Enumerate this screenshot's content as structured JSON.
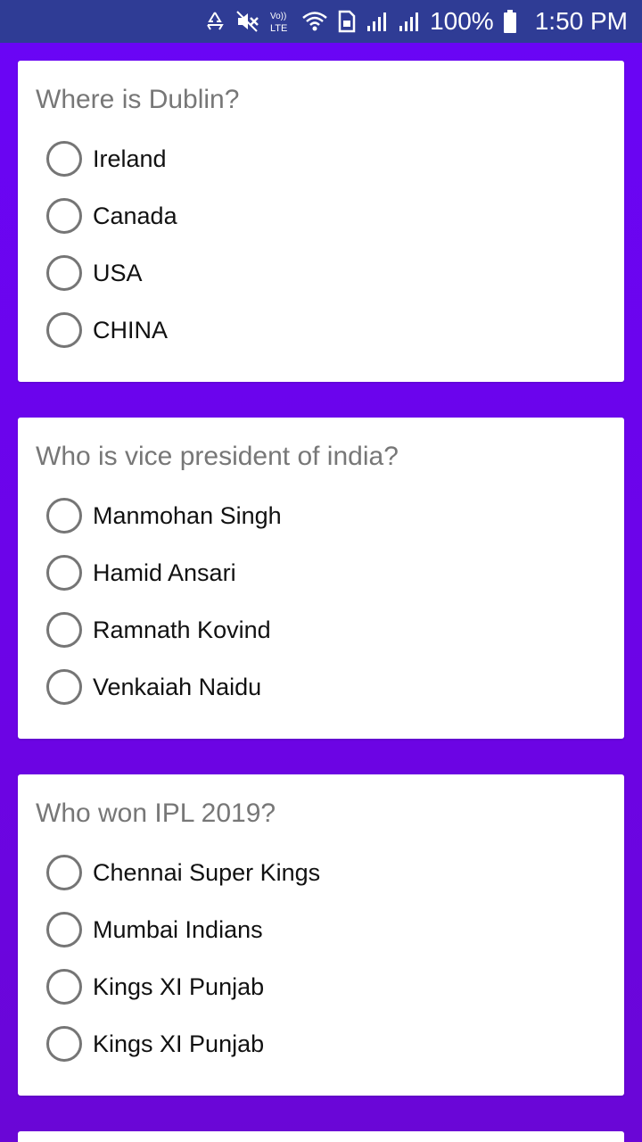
{
  "status_bar": {
    "battery": "100%",
    "time": "1:50 PM",
    "volte_label": "Vo))\nLTE",
    "icons": [
      "recycle-icon",
      "mute-icon",
      "volte-icon",
      "wifi-icon",
      "sim-icon",
      "signal-icon",
      "signal-icon",
      "battery-icon"
    ]
  },
  "quiz": {
    "questions": [
      {
        "question": "Where is Dublin?",
        "options": [
          "Ireland",
          "Canada",
          "USA",
          "CHINA"
        ]
      },
      {
        "question": "Who is vice president of india?",
        "options": [
          "Manmohan Singh",
          "Hamid Ansari",
          "Ramnath Kovind",
          "Venkaiah Naidu"
        ]
      },
      {
        "question": "Who won IPL 2019?",
        "options": [
          "Chennai Super Kings",
          "Mumbai Indians",
          "Kings XI Punjab",
          "Kings XI Punjab"
        ]
      }
    ]
  },
  "colors": {
    "status_bar": "#2f3c95",
    "background": "#6a05f6",
    "card": "#ffffff",
    "question_text": "#777777",
    "radio_border": "#757575"
  }
}
